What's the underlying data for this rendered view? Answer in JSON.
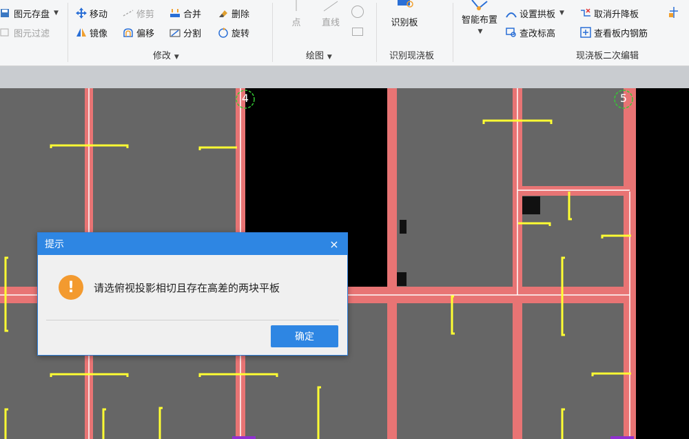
{
  "ribbon": {
    "modify_group": {
      "title": "修改",
      "store_label": "图元存盘",
      "filter_label": "图元过滤",
      "move_label": "移动",
      "mirror_label": "镜像",
      "trim_label": "修剪",
      "offset_label": "偏移",
      "merge_label": "合并",
      "split_label": "分割",
      "delete_label": "删除",
      "rotate_label": "旋转"
    },
    "draw_group": {
      "title": "绘图",
      "point_label": "点",
      "line_label": "直线"
    },
    "identify_group": {
      "title": "识别现浇板",
      "identify_label": "识别板"
    },
    "edit_group": {
      "title": "现浇板二次编辑",
      "smart_layout_label": "智能布置",
      "set_arch_label": "设置拱板",
      "view_elevation_label": "查改标高",
      "cancel_lift_label": "取消升降板",
      "view_rebar_label": "查看板内钢筋"
    }
  },
  "canvas": {
    "axis_labels": [
      "4",
      "5"
    ]
  },
  "dialog": {
    "title": "提示",
    "close_glyph": "×",
    "icon_glyph": "!",
    "message": "请选俯视投影相切且存在高差的两块平板",
    "ok_label": "确定"
  },
  "colors": {
    "ribbon_bg": "#f5f6f7",
    "dialog_accent": "#2e86e3",
    "warning": "#f39a2f",
    "slab": "#666666",
    "beam": "#e87474",
    "rebar": "#ffff33"
  }
}
